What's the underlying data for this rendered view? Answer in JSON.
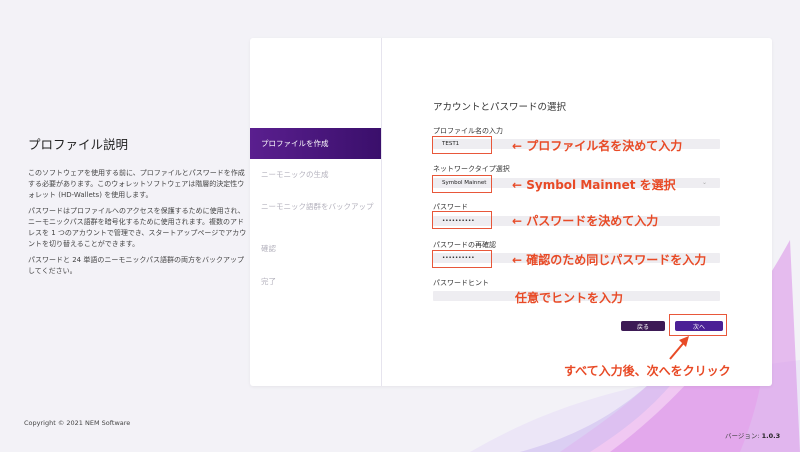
{
  "intro": {
    "title": "プロファイル説明",
    "paragraphs": [
      "このソフトウェアを使用する前に、プロファイルとパスワードを作成する必要があります。このウォレットソフトウェアは階層的決定性ウォレット (HD-Wallets) を使用します。",
      "パスワードはプロファイルへのアクセスを保護するために使用され、ニーモニックパス語群を暗号化するために使用されます。複数のアドレスを 1 つのアカウントで管理でき、スタートアップページでアカウントを切り替えることができます。",
      "パスワードと 24 単語のニーモニックパス語群の両方をバックアップしてください。"
    ]
  },
  "steps": [
    {
      "label": "プロファイルを作成",
      "active": true
    },
    {
      "label": "ニーモニックの生成",
      "active": false
    },
    {
      "label": "ニーモニック語群をバックアップ",
      "active": false
    },
    {
      "label": "確認",
      "active": false
    },
    {
      "label": "完了",
      "active": false
    }
  ],
  "form": {
    "title": "アカウントとパスワードの選択",
    "profile_name_label": "プロファイル名の入力",
    "profile_name_value": "TEST1",
    "network_label": "ネットワークタイプ選択",
    "network_value": "Symbol Mainnet",
    "password_label": "パスワード",
    "password_value": "••••••••••",
    "password_confirm_label": "パスワードの再確認",
    "password_confirm_value": "••••••••••",
    "hint_label": "パスワードヒント",
    "hint_value": "",
    "back_label": "戻る",
    "next_label": "次へ"
  },
  "annotations": {
    "profile": "← プロファイル名を決めて入力",
    "network": "← Symbol Mainnet を選択",
    "password": "← パスワードを決めて入力",
    "confirm": "← 確認のため同じパスワードを入力",
    "hint": "任意でヒントを入力",
    "click": "すべて入力後、次へをクリック"
  },
  "footer": {
    "copyright": "Copyright © 2021 NEM Software",
    "version_label": "バージョン: ",
    "version": "1.0.3"
  },
  "colors": {
    "accent": "#4b2196",
    "step_active": "#5a1f8f",
    "annotation": "#e84a26"
  }
}
